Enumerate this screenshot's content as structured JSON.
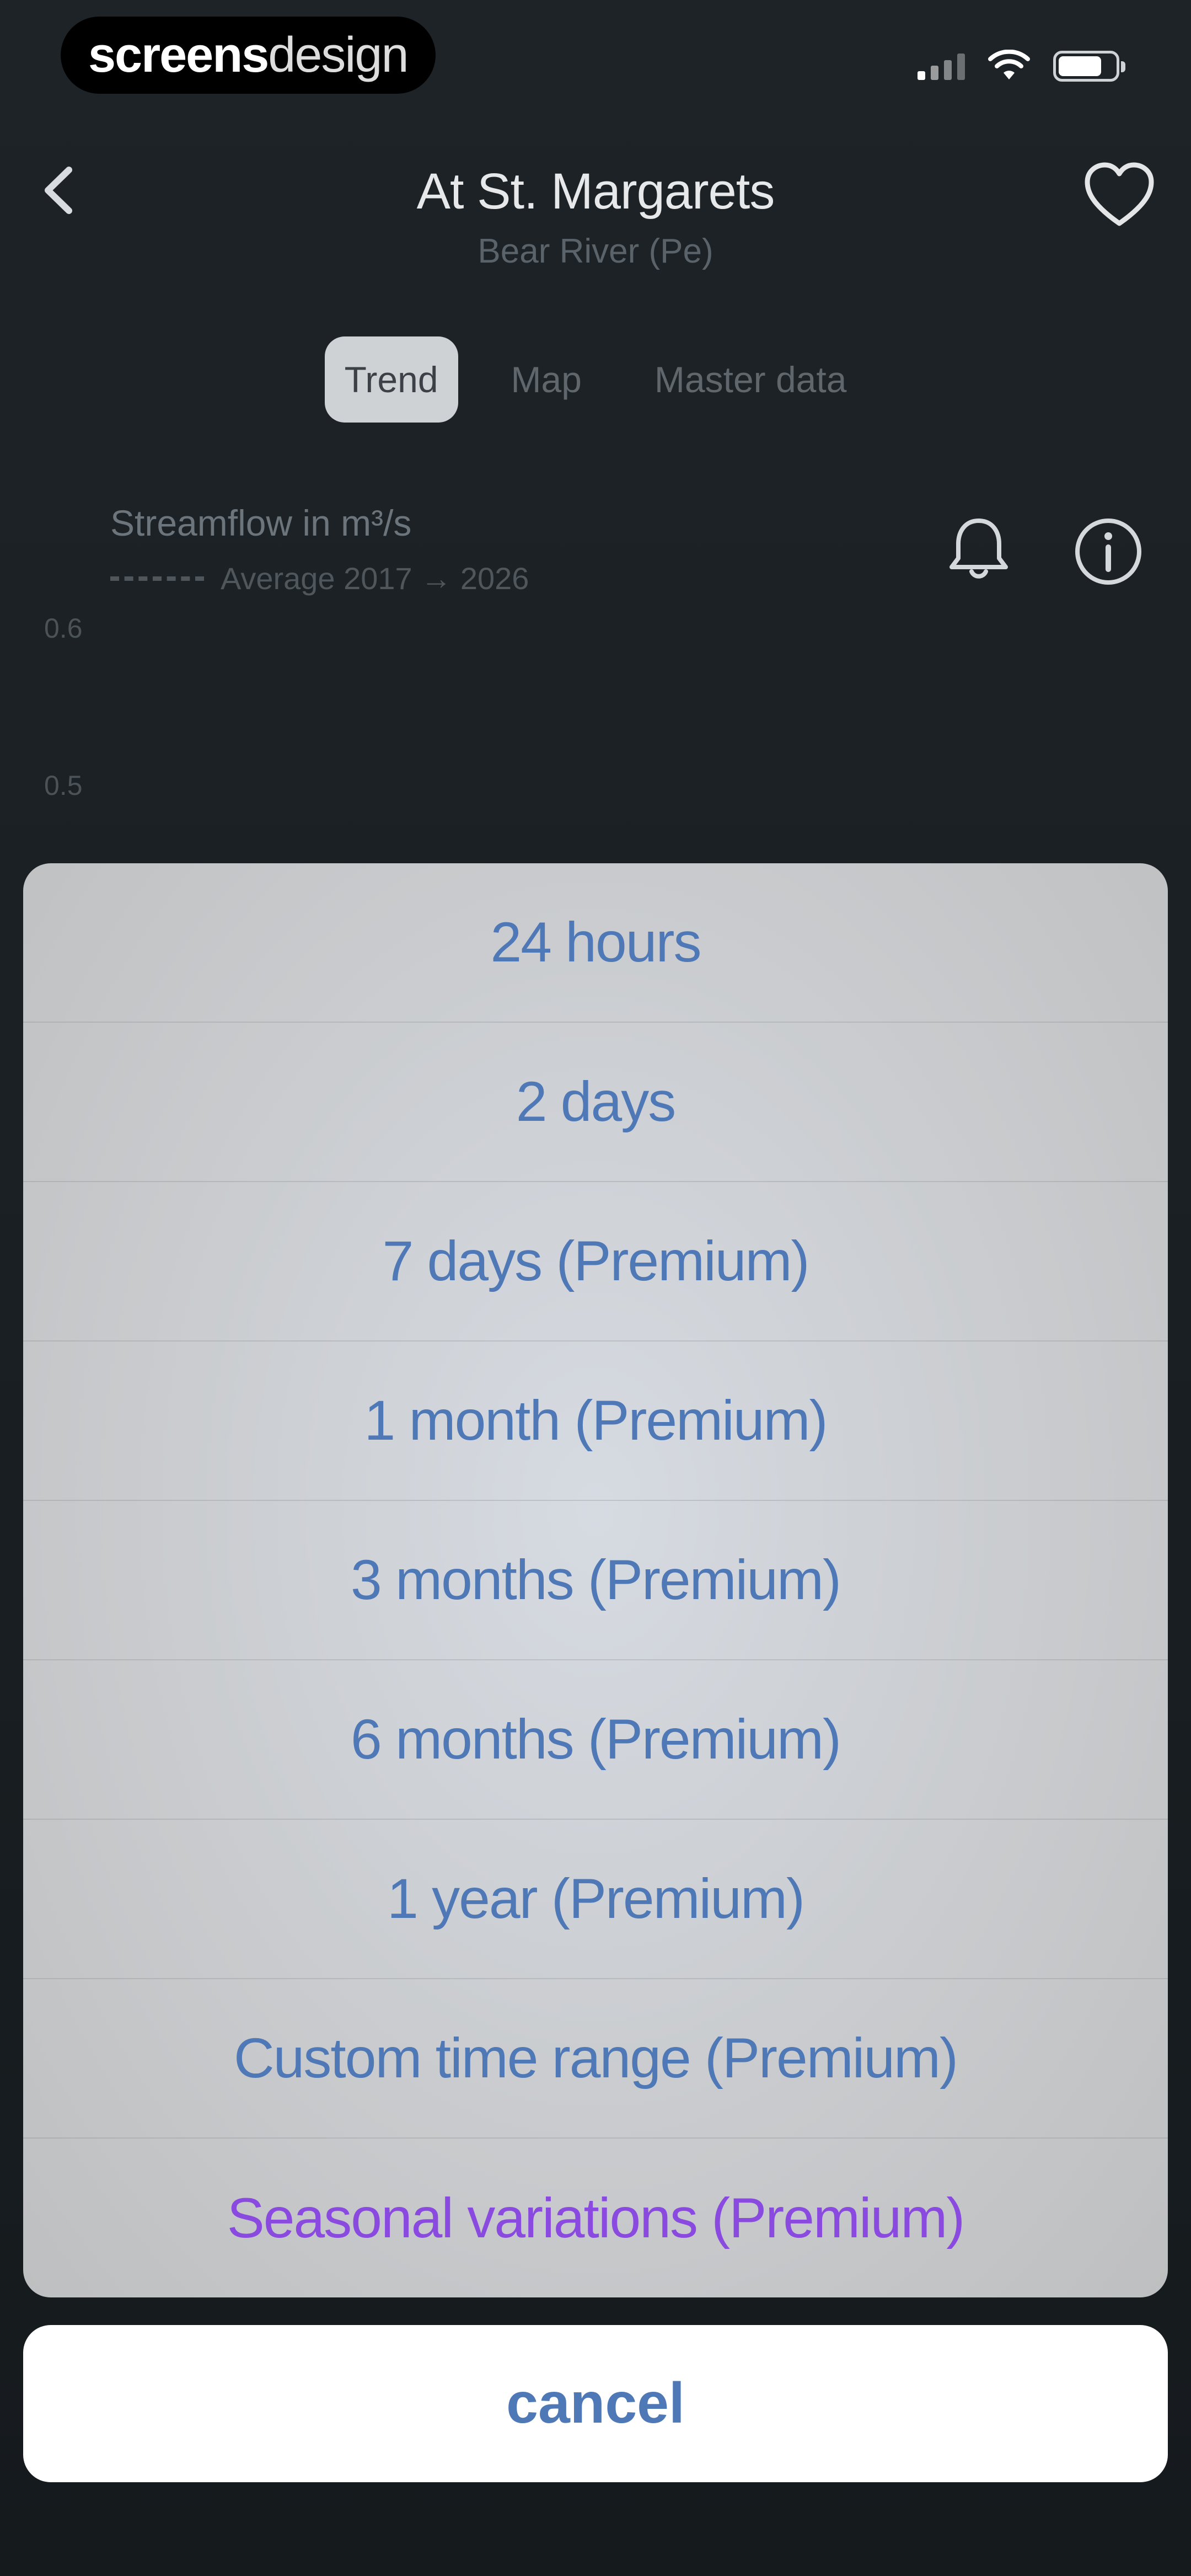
{
  "watermark": {
    "part1": "screens",
    "part2": "design"
  },
  "nav": {
    "title": "At St. Margarets",
    "subtitle": "Bear River (Pe)"
  },
  "tabs": [
    {
      "label": "Trend",
      "active": true
    },
    {
      "label": "Map",
      "active": false
    },
    {
      "label": "Master data",
      "active": false
    }
  ],
  "chart": {
    "title": "Streamflow in m³/s",
    "legend": "Average 2017 → 2026",
    "y_ticks": [
      "0.6",
      "0.5"
    ]
  },
  "action_sheet": {
    "options": [
      "24 hours",
      "2 days",
      "7 days (Premium)",
      "1 month (Premium)",
      "3 months (Premium)",
      "6 months (Premium)",
      "1 year (Premium)",
      "Custom time range (Premium)",
      "Seasonal variations (Premium)"
    ],
    "cancel_label": "cancel"
  },
  "colors": {
    "option_text": "#4f78b7",
    "seasonal_text": "#8a4ae0",
    "background": "#1b2126"
  }
}
